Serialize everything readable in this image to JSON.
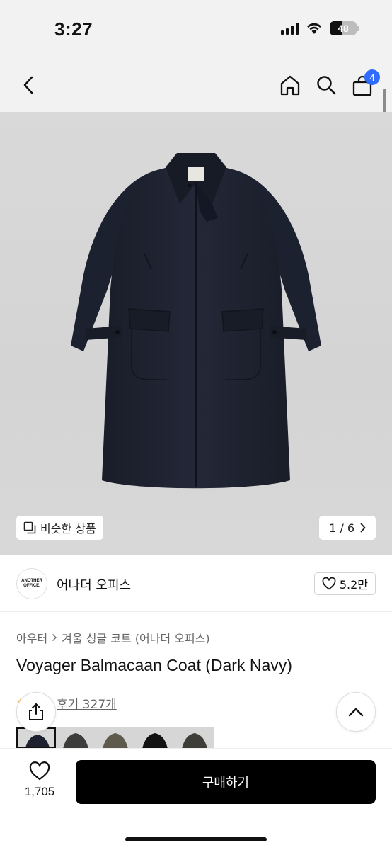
{
  "status": {
    "time": "3:27",
    "battery": "48",
    "battery_level_percent": 48
  },
  "nav": {
    "cart_count": "4"
  },
  "gallery": {
    "similar_label": "비슷한 상품",
    "pager": "1 / 6"
  },
  "brand": {
    "logo_line1": "ANOTHER",
    "logo_line2": "OFFICE.",
    "name": "어나더 오피스",
    "likes": "5.2만"
  },
  "product": {
    "breadcrumb": [
      "아우터",
      "겨울 싱글 코트 (어나더 오피스)"
    ],
    "title": "Voyager Balmacaan Coat (Dark Navy)",
    "review": "후기 327개"
  },
  "bottom": {
    "wish_count": "1,705",
    "buy_label": "구매하기"
  },
  "colors": {
    "accent": "#2f6bff",
    "coat_navy": "#1f2433",
    "buy_button": "#000000"
  },
  "icons": [
    "back-icon",
    "home-icon",
    "search-icon",
    "cart-icon",
    "similar-icon",
    "chevron-right-icon",
    "heart-icon",
    "share-icon",
    "chevron-up-icon"
  ]
}
